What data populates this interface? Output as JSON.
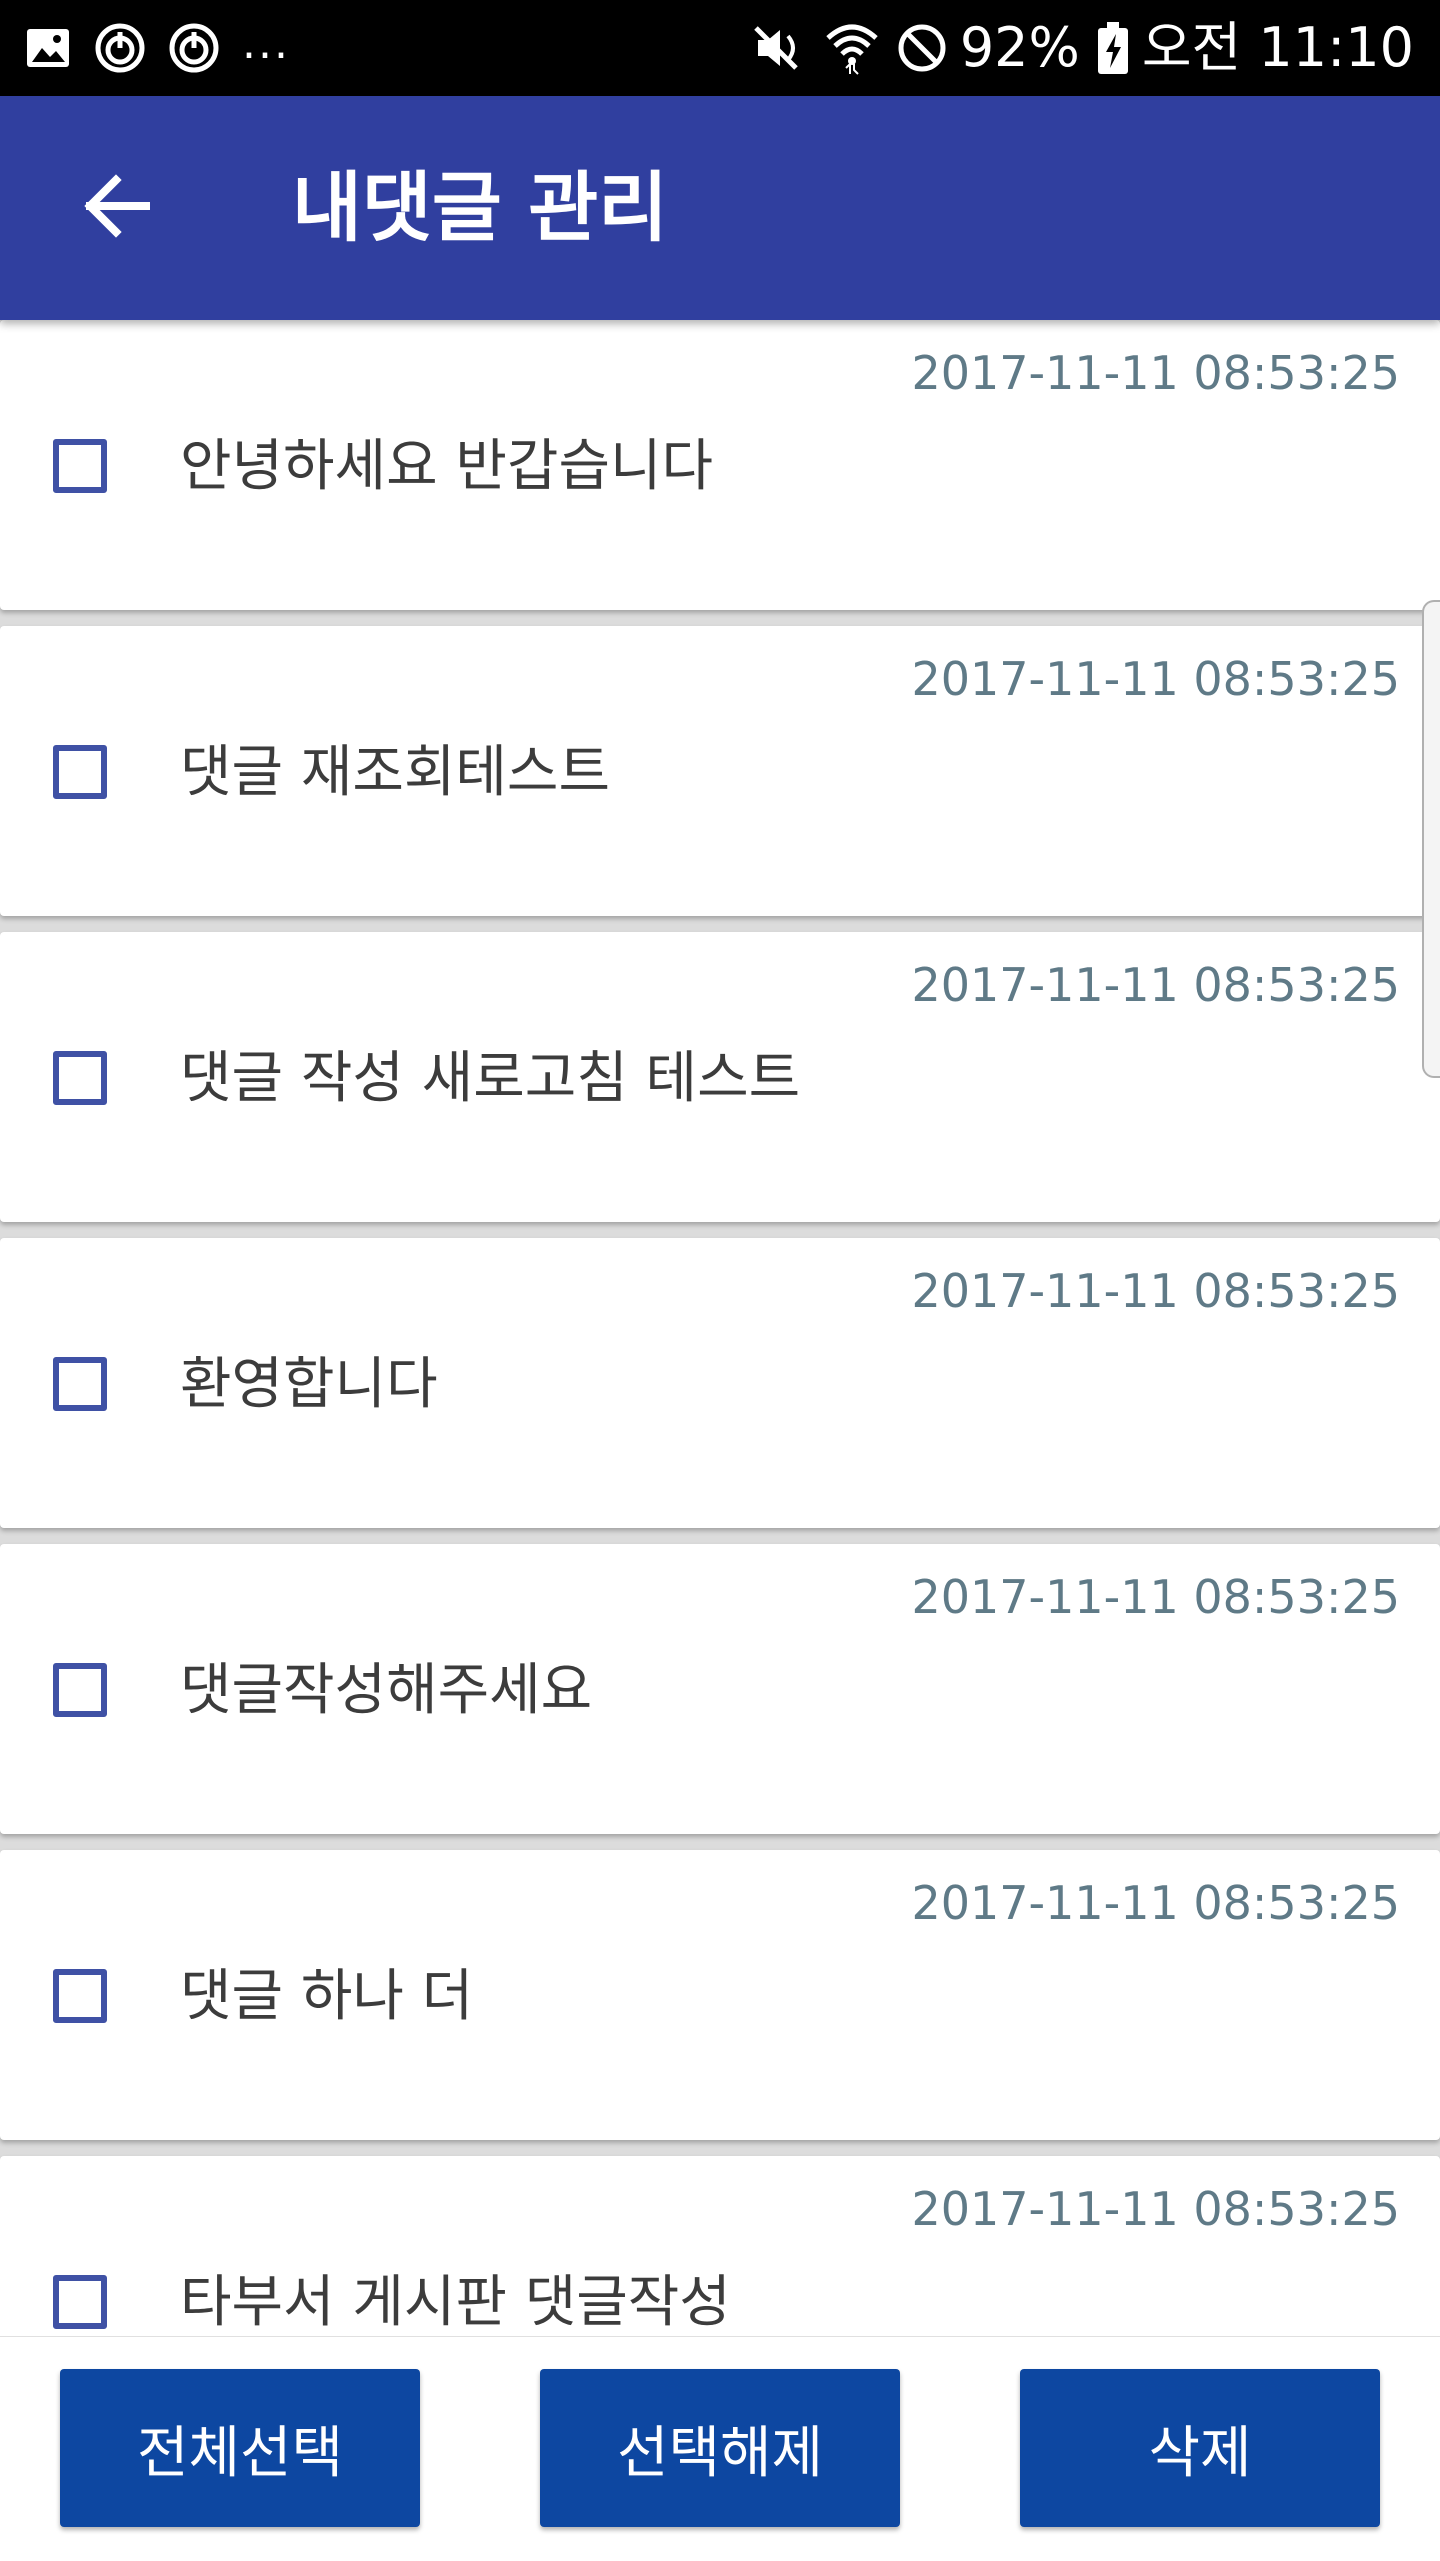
{
  "status_bar": {
    "battery_percent": "92%",
    "time": "오전 11:10",
    "overflow_dots": "...",
    "left_icons": [
      "image-icon",
      "sync-icon",
      "sync-icon"
    ],
    "right_icons": [
      "mute-icon",
      "wifi-icon",
      "do-not-disturb-icon",
      "battery-charging-icon"
    ]
  },
  "app_bar": {
    "title": "내댓글 관리",
    "back_icon": "arrow-back-icon"
  },
  "comments": [
    {
      "text": "안녕하세요 반갑습니다",
      "date": "2017-11-11 08:53:25",
      "checked": false
    },
    {
      "text": "댓글 재조회테스트",
      "date": "2017-11-11 08:53:25",
      "checked": false
    },
    {
      "text": "댓글 작성 새로고침 테스트",
      "date": "2017-11-11 08:53:25",
      "checked": false
    },
    {
      "text": "환영합니다",
      "date": "2017-11-11 08:53:25",
      "checked": false
    },
    {
      "text": "댓글작성해주세요",
      "date": "2017-11-11 08:53:25",
      "checked": false
    },
    {
      "text": "댓글 하나 더",
      "date": "2017-11-11 08:53:25",
      "checked": false
    },
    {
      "text": "타부서 게시판 댓글작성",
      "date": "2017-11-11 08:53:25",
      "checked": false
    }
  ],
  "actions": {
    "select_all": "전체선택",
    "deselect": "선택해제",
    "delete": "삭제"
  },
  "colors": {
    "app_bar": "#303f9f",
    "button": "#0d47a1",
    "checkbox": "#3f51a5",
    "date_text": "#5f7a87"
  }
}
